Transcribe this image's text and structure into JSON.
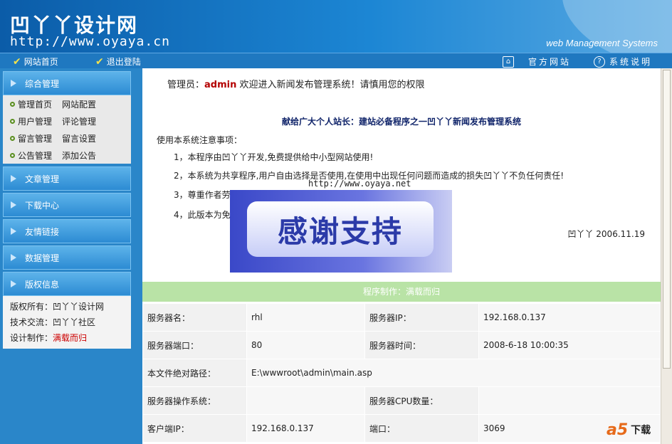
{
  "header": {
    "logo": "凹丫丫设计网",
    "url": "http://www.oyaya.cn",
    "system": "web Management Systems"
  },
  "nav": {
    "home": "网站首页",
    "logout": "退出登陆",
    "official": "官方网站",
    "help": "系统说明"
  },
  "sidebar": {
    "sections": [
      "综合管理",
      "文章管理",
      "下载中心",
      "友情链接",
      "数据管理",
      "版权信息"
    ],
    "submenu": [
      {
        "a": "管理首页",
        "b": "网站配置"
      },
      {
        "a": "用户管理",
        "b": "评论管理"
      },
      {
        "a": "留言管理",
        "b": "留言设置"
      },
      {
        "a": "公告管理",
        "b": "添加公告"
      }
    ],
    "copyright": {
      "owner_label": "版权所有：",
      "owner": "凹丫丫设计网",
      "tech_label": "技术交流：",
      "tech": "凹丫丫社区",
      "design_label": "设计制作：",
      "design": "满载而归"
    }
  },
  "main": {
    "welcome_prefix": "管理员：",
    "admin": "admin",
    "welcome_suffix": " 欢迎进入新闻发布管理系统！请慎用您的权限",
    "dedication": "献给广大个人站长：建站必备程序之一凹丫丫新闻发布管理系统",
    "notes_title": "使用本系统注意事项：",
    "notes": [
      "1，本程序由凹丫丫开发,免费提供给中小型网站使用!",
      "2，本系统为共享程序,用户自由选择是否使用,在使用中出现任何问题而造成的损失凹丫丫不负任何责任!",
      "3，尊重作者劳动成果",
      "4，此版本为免"
    ],
    "signature": "凹丫丫  2006.11.19",
    "site": "http://www.oyaya.net",
    "thanks": "感谢支持",
    "bar_prefix": "程序制作：",
    "bar_name": "满载而归",
    "rows": [
      [
        "服务器名：",
        "rhl",
        "服务器IP：",
        "192.168.0.137"
      ],
      [
        "服务器端口：",
        "80",
        "服务器时间：",
        "2008-6-18 10:00:35"
      ],
      [
        "本文件绝对路径：",
        "E:\\wwwroot\\admin\\main.asp",
        "",
        ""
      ],
      [
        "服务器操作系统：",
        "",
        "服务器CPU数量：",
        ""
      ],
      [
        "客户端IP：",
        "192.168.0.137",
        "端口：",
        "3069"
      ]
    ]
  },
  "watermark": {
    "a5": "a5",
    "text": "下载"
  }
}
